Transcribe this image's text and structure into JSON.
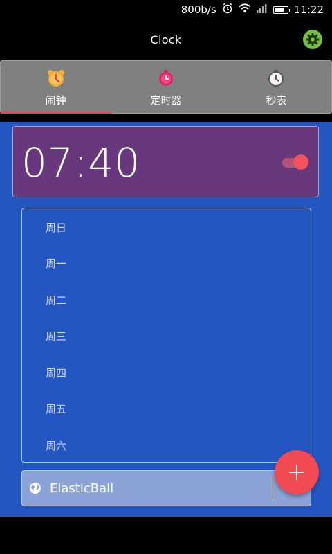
{
  "status_bar": {
    "net_speed": "800b/s",
    "time": "11:22",
    "icons": [
      "alarm-icon",
      "wifi-icon",
      "signal-icon",
      "battery-icon"
    ],
    "battery_level": 0.75
  },
  "app_bar": {
    "title": "Clock",
    "settings_icon": "gear-icon",
    "settings_color": "#77c043"
  },
  "tabs": [
    {
      "label": "闹钟",
      "icon": "alarm-clock-icon",
      "selected": true
    },
    {
      "label": "定时器",
      "icon": "timer-icon",
      "selected": false
    },
    {
      "label": "秒表",
      "icon": "stopwatch-icon",
      "selected": false
    }
  ],
  "alarm": {
    "time": "07:40",
    "enabled": true
  },
  "days": [
    "周日",
    "周一",
    "周二",
    "周三",
    "周四",
    "周五",
    "周六"
  ],
  "ringtone": {
    "label": "ElasticBall",
    "icon": "globe-icon"
  },
  "fab": {
    "label": "+",
    "icon": "plus-icon"
  },
  "colors": {
    "accent": "#f24a52",
    "content_bg": "#2456c2",
    "alarm_card_bg": "#67387c",
    "tab_bg": "#808080",
    "tab_indicator": "#e8453c"
  }
}
